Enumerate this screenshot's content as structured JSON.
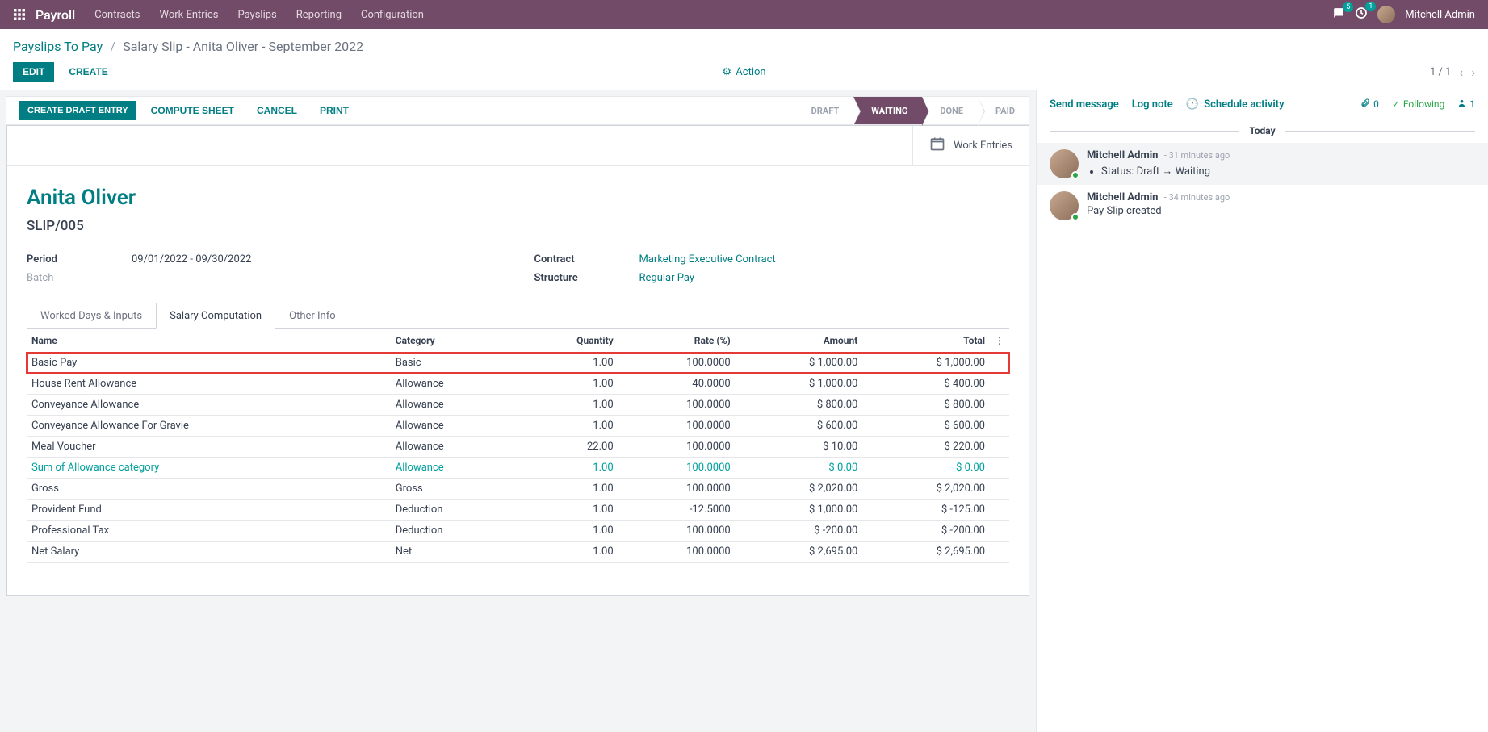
{
  "topbar": {
    "app_title": "Payroll",
    "menus": [
      "Contracts",
      "Work Entries",
      "Payslips",
      "Reporting",
      "Configuration"
    ],
    "chat_count": "5",
    "activity_count": "1",
    "username": "Mitchell Admin"
  },
  "breadcrumb": {
    "parent": "Payslips To Pay",
    "current": "Salary Slip - Anita Oliver - September 2022"
  },
  "controls": {
    "edit": "EDIT",
    "create": "CREATE",
    "action": "Action",
    "pager": "1 / 1"
  },
  "statusbar": {
    "create_draft": "CREATE DRAFT ENTRY",
    "compute": "COMPUTE SHEET",
    "cancel": "CANCEL",
    "print": "PRINT",
    "stages": [
      "DRAFT",
      "WAITING",
      "DONE",
      "PAID"
    ],
    "active_index": 1
  },
  "statbutton": {
    "work_entries": "Work Entries"
  },
  "record": {
    "employee": "Anita Oliver",
    "number": "SLIP/005",
    "period_label": "Period",
    "period_value": "09/01/2022 - 09/30/2022",
    "batch_label": "Batch",
    "batch_value": "",
    "contract_label": "Contract",
    "contract_value": "Marketing Executive Contract",
    "structure_label": "Structure",
    "structure_value": "Regular Pay"
  },
  "tabs": {
    "worked": "Worked Days & Inputs",
    "salary": "Salary Computation",
    "other": "Other Info"
  },
  "table": {
    "headers": {
      "name": "Name",
      "category": "Category",
      "quantity": "Quantity",
      "rate": "Rate (%)",
      "amount": "Amount",
      "total": "Total"
    },
    "rows": [
      {
        "name": "Basic Pay",
        "category": "Basic",
        "quantity": "1.00",
        "rate": "100.0000",
        "amount": "$ 1,000.00",
        "total": "$ 1,000.00",
        "highlight": true
      },
      {
        "name": "House Rent Allowance",
        "category": "Allowance",
        "quantity": "1.00",
        "rate": "40.0000",
        "amount": "$ 1,000.00",
        "total": "$ 400.00"
      },
      {
        "name": "Conveyance Allowance",
        "category": "Allowance",
        "quantity": "1.00",
        "rate": "100.0000",
        "amount": "$ 800.00",
        "total": "$ 800.00"
      },
      {
        "name": "Conveyance Allowance For Gravie",
        "category": "Allowance",
        "quantity": "1.00",
        "rate": "100.0000",
        "amount": "$ 600.00",
        "total": "$ 600.00"
      },
      {
        "name": "Meal Voucher",
        "category": "Allowance",
        "quantity": "22.00",
        "rate": "100.0000",
        "amount": "$ 10.00",
        "total": "$ 220.00"
      },
      {
        "name": "Sum of Allowance category",
        "category": "Allowance",
        "quantity": "1.00",
        "rate": "100.0000",
        "amount": "$ 0.00",
        "total": "$ 0.00",
        "teal": true
      },
      {
        "name": "Gross",
        "category": "Gross",
        "quantity": "1.00",
        "rate": "100.0000",
        "amount": "$ 2,020.00",
        "total": "$ 2,020.00"
      },
      {
        "name": "Provident Fund",
        "category": "Deduction",
        "quantity": "1.00",
        "rate": "-12.5000",
        "amount": "$ 1,000.00",
        "total": "$ -125.00"
      },
      {
        "name": "Professional Tax",
        "category": "Deduction",
        "quantity": "1.00",
        "rate": "100.0000",
        "amount": "$ -200.00",
        "total": "$ -200.00"
      },
      {
        "name": "Net Salary",
        "category": "Net",
        "quantity": "1.00",
        "rate": "100.0000",
        "amount": "$ 2,695.00",
        "total": "$ 2,695.00"
      }
    ]
  },
  "chatter": {
    "send": "Send message",
    "log": "Log note",
    "schedule": "Schedule activity",
    "attach_count": "0",
    "following": "Following",
    "followers": "1",
    "today": "Today",
    "messages": [
      {
        "author": "Mitchell Admin",
        "time": "- 31 minutes ago",
        "status_label": "Status:",
        "from": "Draft",
        "to": "Waiting"
      },
      {
        "author": "Mitchell Admin",
        "time": "- 34 minutes ago",
        "text": "Pay Slip created"
      }
    ]
  }
}
